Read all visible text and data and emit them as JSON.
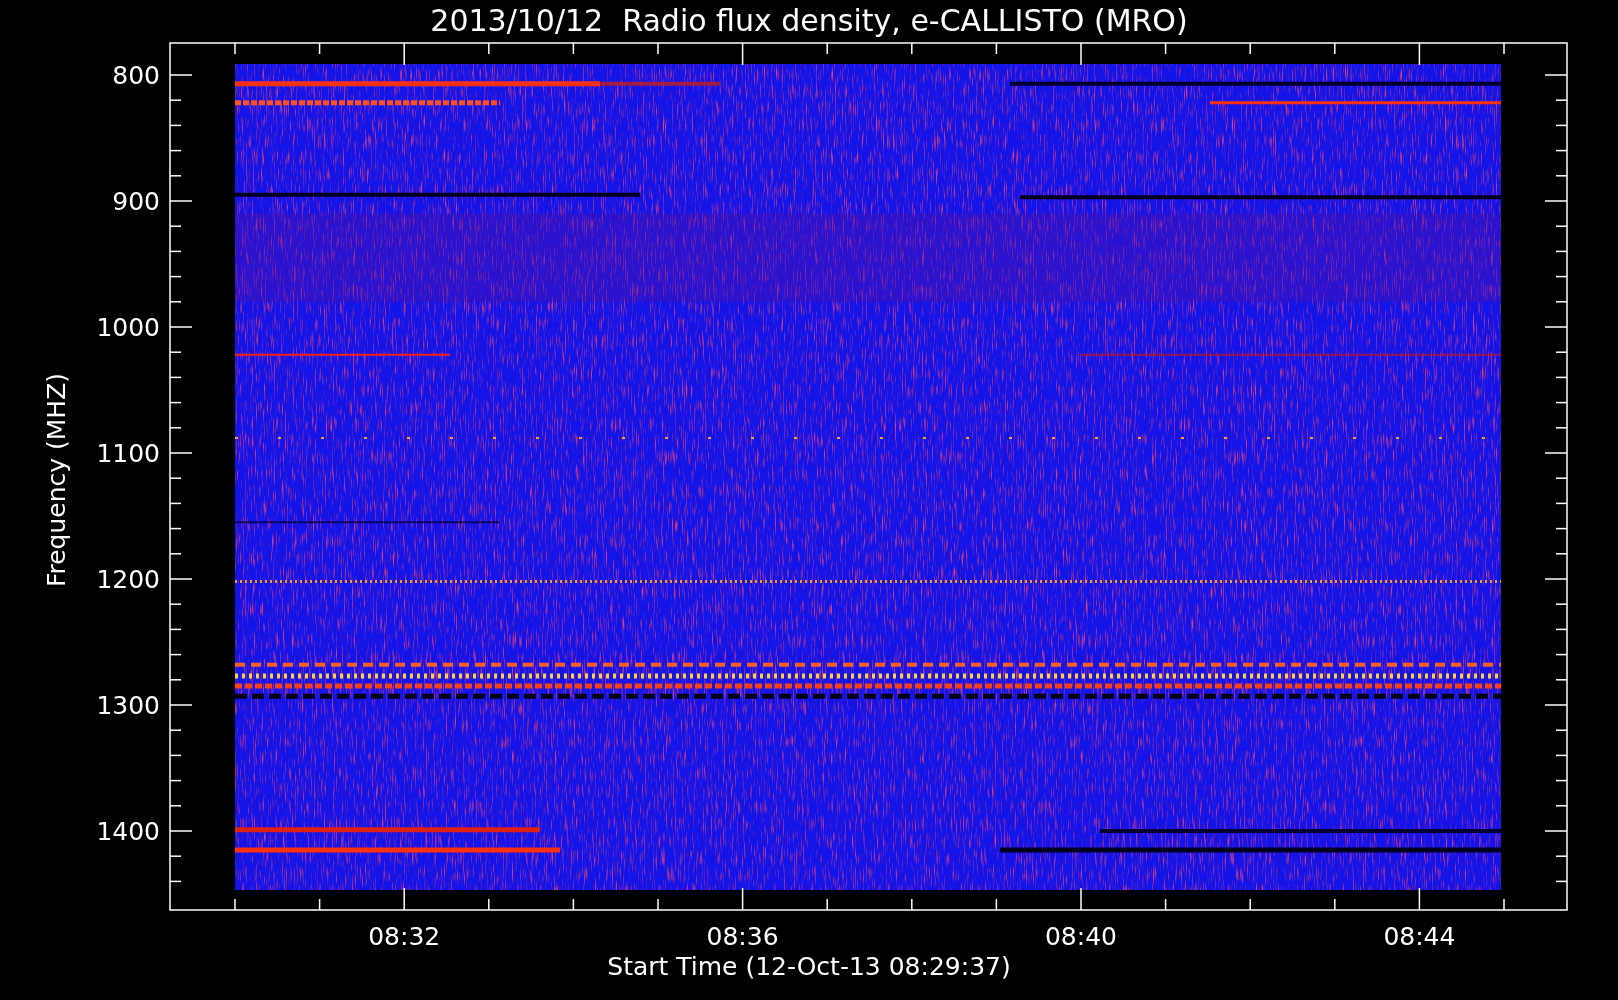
{
  "title": "2013/10/12  Radio flux density, e-CALLISTO (MRO)",
  "plot": {
    "ylabel": "Frequency (MHZ)",
    "xlabel": "Start Time (12-Oct-13 08:29:37)",
    "yticks": [
      "800",
      "900",
      "1000",
      "1100",
      "1200",
      "1300",
      "1400"
    ],
    "xticks": [
      "08:32",
      "08:36",
      "08:40",
      "08:44"
    ]
  }
}
